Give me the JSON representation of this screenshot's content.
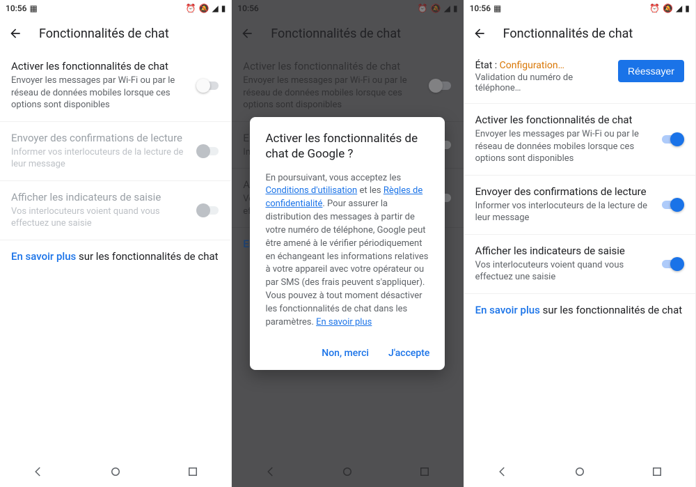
{
  "status": {
    "time": "10:56",
    "icons": [
      "image-icon",
      "alarm-icon",
      "dnd-icon",
      "signal-icon",
      "data-icon",
      "battery-icon"
    ]
  },
  "appbar": {
    "title": "Fonctionnalités de chat"
  },
  "settings": {
    "enable": {
      "title": "Activer les fonctionnalités de chat",
      "subtitle": "Envoyer les messages par Wi-Fi ou par le réseau de données mobiles lorsque ces options sont disponibles"
    },
    "readconf": {
      "title": "Envoyer des confirmations de lecture",
      "subtitle": "Informer vos interlocuteurs de la lecture de leur message"
    },
    "typing": {
      "title": "Afficher les indicateurs de saisie",
      "subtitle": "Vos interlocuteurs voient quand vous effectuez une saisie"
    }
  },
  "learnmore": {
    "link": "En savoir plus",
    "suffix": " sur les fonctionnalités de chat"
  },
  "dialog": {
    "title": "Activer les fonctionnalités de chat de Google ?",
    "body_pre": "En poursuivant, vous acceptez les ",
    "tos": "Conditions d'utilisation",
    "body_and": " et les ",
    "privacy": "Règles de confidentialité",
    "body_post": ". Pour assurer la distribution des messages à partir de votre numéro de téléphone, Google peut être amené à le vérifier périodiquement en échangeant les informations relatives à votre appareil avec votre opérateur ou par SMS (des frais peuvent s'appliquer). Vous pouvez à tout moment désactiver les fonctionnalités de chat dans les paramètres. ",
    "learn": "En savoir plus",
    "decline": "Non, merci",
    "accept": "J'accepte"
  },
  "status_row": {
    "label": "État : ",
    "value": "Configuration…",
    "sub": "Validation du numéro de téléphone…",
    "retry": "Réessayer"
  }
}
